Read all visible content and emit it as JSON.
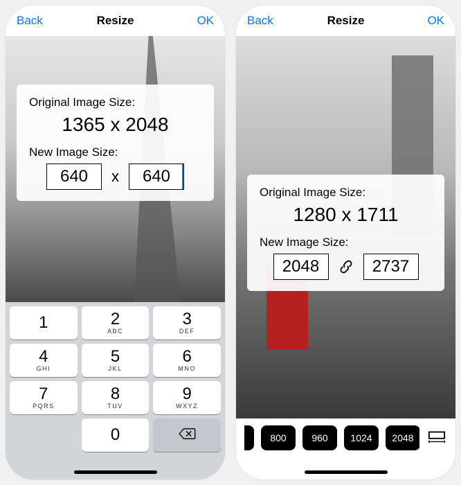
{
  "left": {
    "nav": {
      "back": "Back",
      "title": "Resize",
      "ok": "OK"
    },
    "panel": {
      "original_label": "Original Image Size:",
      "original_size": "1365 x 2048",
      "new_label": "New Image Size:",
      "width": "640",
      "height": "640",
      "separator": "x"
    },
    "keypad": {
      "keys": [
        {
          "d": "1",
          "l": ""
        },
        {
          "d": "2",
          "l": "ABC"
        },
        {
          "d": "3",
          "l": "DEF"
        },
        {
          "d": "4",
          "l": "GHI"
        },
        {
          "d": "5",
          "l": "JKL"
        },
        {
          "d": "6",
          "l": "MNO"
        },
        {
          "d": "7",
          "l": "PQRS"
        },
        {
          "d": "8",
          "l": "TUV"
        },
        {
          "d": "9",
          "l": "WXYZ"
        },
        {
          "d": "0",
          "l": ""
        }
      ]
    }
  },
  "right": {
    "nav": {
      "back": "Back",
      "title": "Resize",
      "ok": "OK"
    },
    "panel": {
      "original_label": "Original Image Size:",
      "original_size": "1280 x 1711",
      "new_label": "New Image Size:",
      "width": "2048",
      "height": "2737"
    },
    "presets": [
      "800",
      "960",
      "1024",
      "2048"
    ]
  }
}
